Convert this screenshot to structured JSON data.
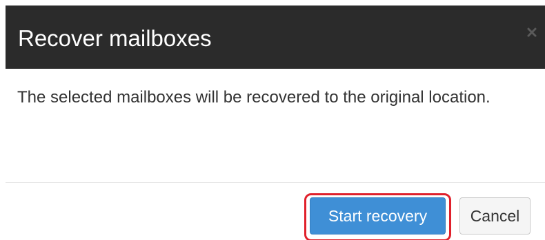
{
  "dialog": {
    "title": "Recover mailboxes",
    "close_icon": "close-icon",
    "message": "The selected mailboxes will be recovered to the original location.",
    "buttons": {
      "primary_label": "Start recovery",
      "cancel_label": "Cancel"
    }
  },
  "colors": {
    "header_background": "#2b2b2b",
    "primary_button": "#3f8fd6",
    "highlight_ring": "#e0202b"
  }
}
